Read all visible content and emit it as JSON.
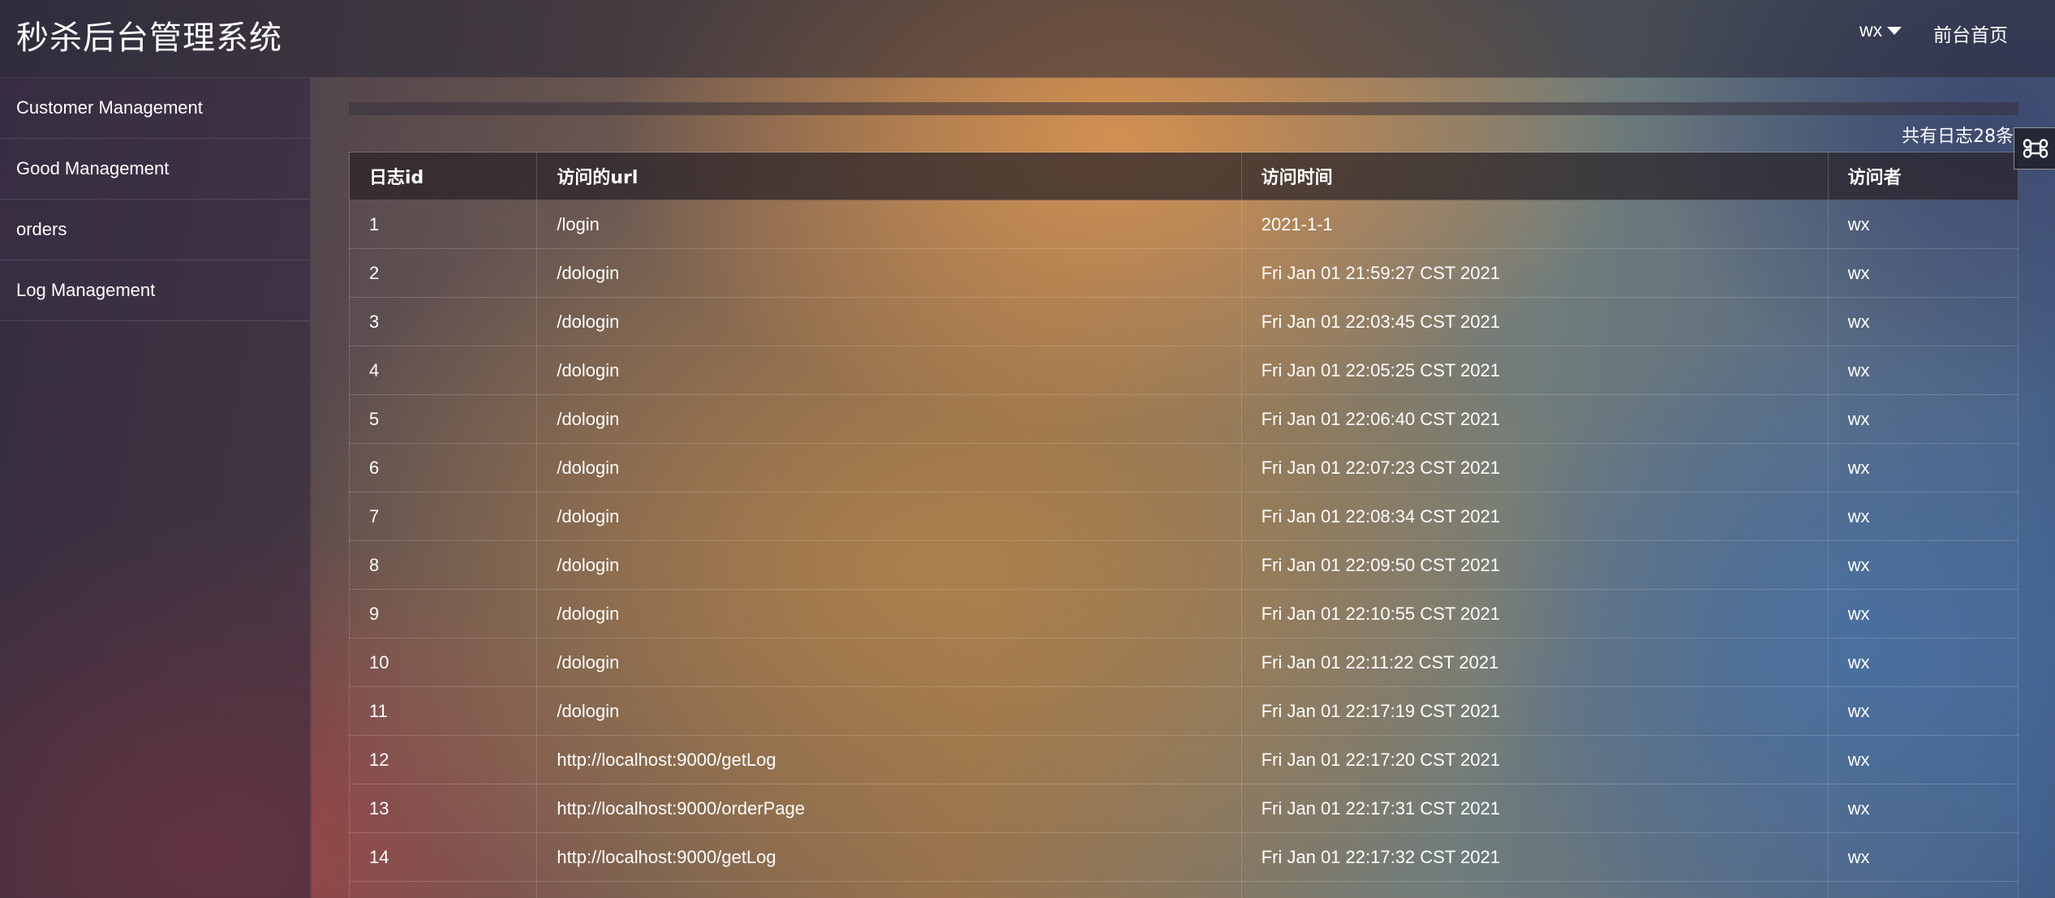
{
  "app": {
    "title": "秒杀后台管理系统"
  },
  "header": {
    "user": "wx",
    "home_link": "前台首页"
  },
  "sidebar": {
    "items": [
      {
        "label": "Customer Management"
      },
      {
        "label": "Good Management"
      },
      {
        "label": "orders"
      },
      {
        "label": "Log Management"
      }
    ]
  },
  "log": {
    "count_text": "共有日志28条",
    "columns": [
      "日志id",
      "访问的url",
      "访问时间",
      "访问者"
    ],
    "rows": [
      [
        "1",
        "/login",
        "2021-1-1",
        "wx"
      ],
      [
        "2",
        "/dologin",
        "Fri Jan 01 21:59:27 CST 2021",
        "wx"
      ],
      [
        "3",
        "/dologin",
        "Fri Jan 01 22:03:45 CST 2021",
        "wx"
      ],
      [
        "4",
        "/dologin",
        "Fri Jan 01 22:05:25 CST 2021",
        "wx"
      ],
      [
        "5",
        "/dologin",
        "Fri Jan 01 22:06:40 CST 2021",
        "wx"
      ],
      [
        "6",
        "/dologin",
        "Fri Jan 01 22:07:23 CST 2021",
        "wx"
      ],
      [
        "7",
        "/dologin",
        "Fri Jan 01 22:08:34 CST 2021",
        "wx"
      ],
      [
        "8",
        "/dologin",
        "Fri Jan 01 22:09:50 CST 2021",
        "wx"
      ],
      [
        "9",
        "/dologin",
        "Fri Jan 01 22:10:55 CST 2021",
        "wx"
      ],
      [
        "10",
        "/dologin",
        "Fri Jan 01 22:11:22 CST 2021",
        "wx"
      ],
      [
        "11",
        "/dologin",
        "Fri Jan 01 22:17:19 CST 2021",
        "wx"
      ],
      [
        "12",
        "http://localhost:9000/getLog",
        "Fri Jan 01 22:17:20 CST 2021",
        "wx"
      ],
      [
        "13",
        "http://localhost:9000/orderPage",
        "Fri Jan 01 22:17:31 CST 2021",
        "wx"
      ],
      [
        "14",
        "http://localhost:9000/getLog",
        "Fri Jan 01 22:17:32 CST 2021",
        "wx"
      ],
      [
        "",
        "",
        "",
        ""
      ]
    ]
  },
  "icons": {
    "float_button": "command-key-icon"
  }
}
